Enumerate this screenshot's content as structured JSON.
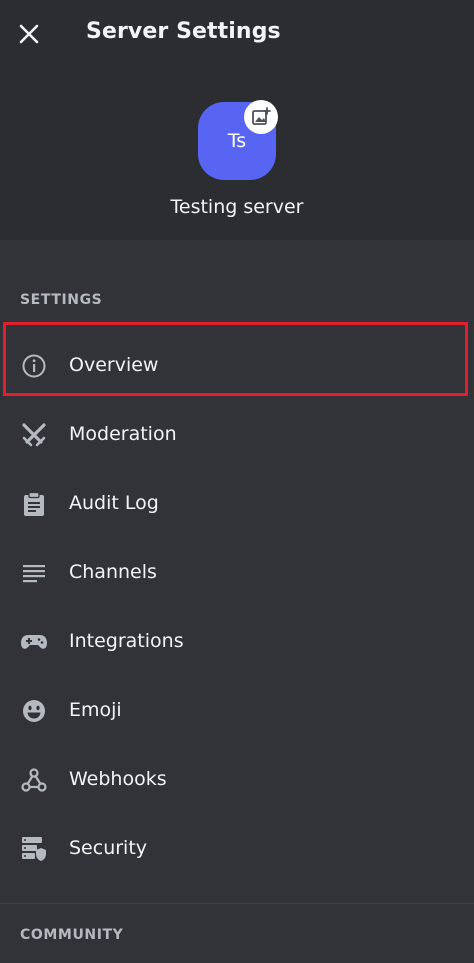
{
  "header": {
    "title": "Server Settings"
  },
  "server": {
    "initials": "Ts",
    "name": "Testing server",
    "avatar_color": "#5865f2"
  },
  "sections": {
    "settings": "SETTINGS",
    "community": "COMMUNITY"
  },
  "nav": {
    "items": [
      {
        "label": "Overview",
        "icon": "info-icon"
      },
      {
        "label": "Moderation",
        "icon": "swords-icon"
      },
      {
        "label": "Audit Log",
        "icon": "clipboard-icon"
      },
      {
        "label": "Channels",
        "icon": "lines-icon"
      },
      {
        "label": "Integrations",
        "icon": "gamepad-icon"
      },
      {
        "label": "Emoji",
        "icon": "smiley-icon"
      },
      {
        "label": "Webhooks",
        "icon": "webhook-icon"
      },
      {
        "label": "Security",
        "icon": "server-shield-icon"
      }
    ]
  },
  "colors": {
    "background": "#313338",
    "panel": "#2b2d31",
    "highlight": "#e0202e"
  }
}
